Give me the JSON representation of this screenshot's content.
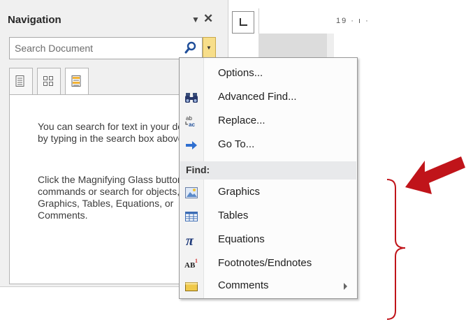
{
  "nav": {
    "title": "Navigation",
    "dropdown_glyph": "▼",
    "close_glyph": "✕",
    "search_placeholder": "Search Document",
    "help_text_1": "You can search for text in your document by typing in the search box above.",
    "help_text_2": "Click the Magnifying Glass button to find commands or search for objects, such as Graphics, Tables, Equations, or Comments."
  },
  "ruler": {
    "ticks": "19 · ı ·"
  },
  "menu": {
    "items": [
      {
        "label": "Options...",
        "icon": "none"
      },
      {
        "label": "Advanced Find...",
        "icon": "binoculars-icon"
      },
      {
        "label": "Replace...",
        "icon": "replace-icon"
      },
      {
        "label": "Go To...",
        "icon": "arrow-right-icon"
      }
    ],
    "find_header": "Find:",
    "find_items": [
      {
        "label": "Graphics",
        "icon": "picture-icon"
      },
      {
        "label": "Tables",
        "icon": "table-icon"
      },
      {
        "label": "Equations",
        "icon": "pi-icon"
      },
      {
        "label": "Footnotes/Endnotes",
        "icon": "footnote-icon"
      },
      {
        "label": "Comments",
        "icon": "comment-icon"
      }
    ]
  },
  "colors": {
    "annotation_red": "#c0141a",
    "menu_header_bg": "#e8e9eb",
    "dropdown_gold": "#f7de8a"
  }
}
